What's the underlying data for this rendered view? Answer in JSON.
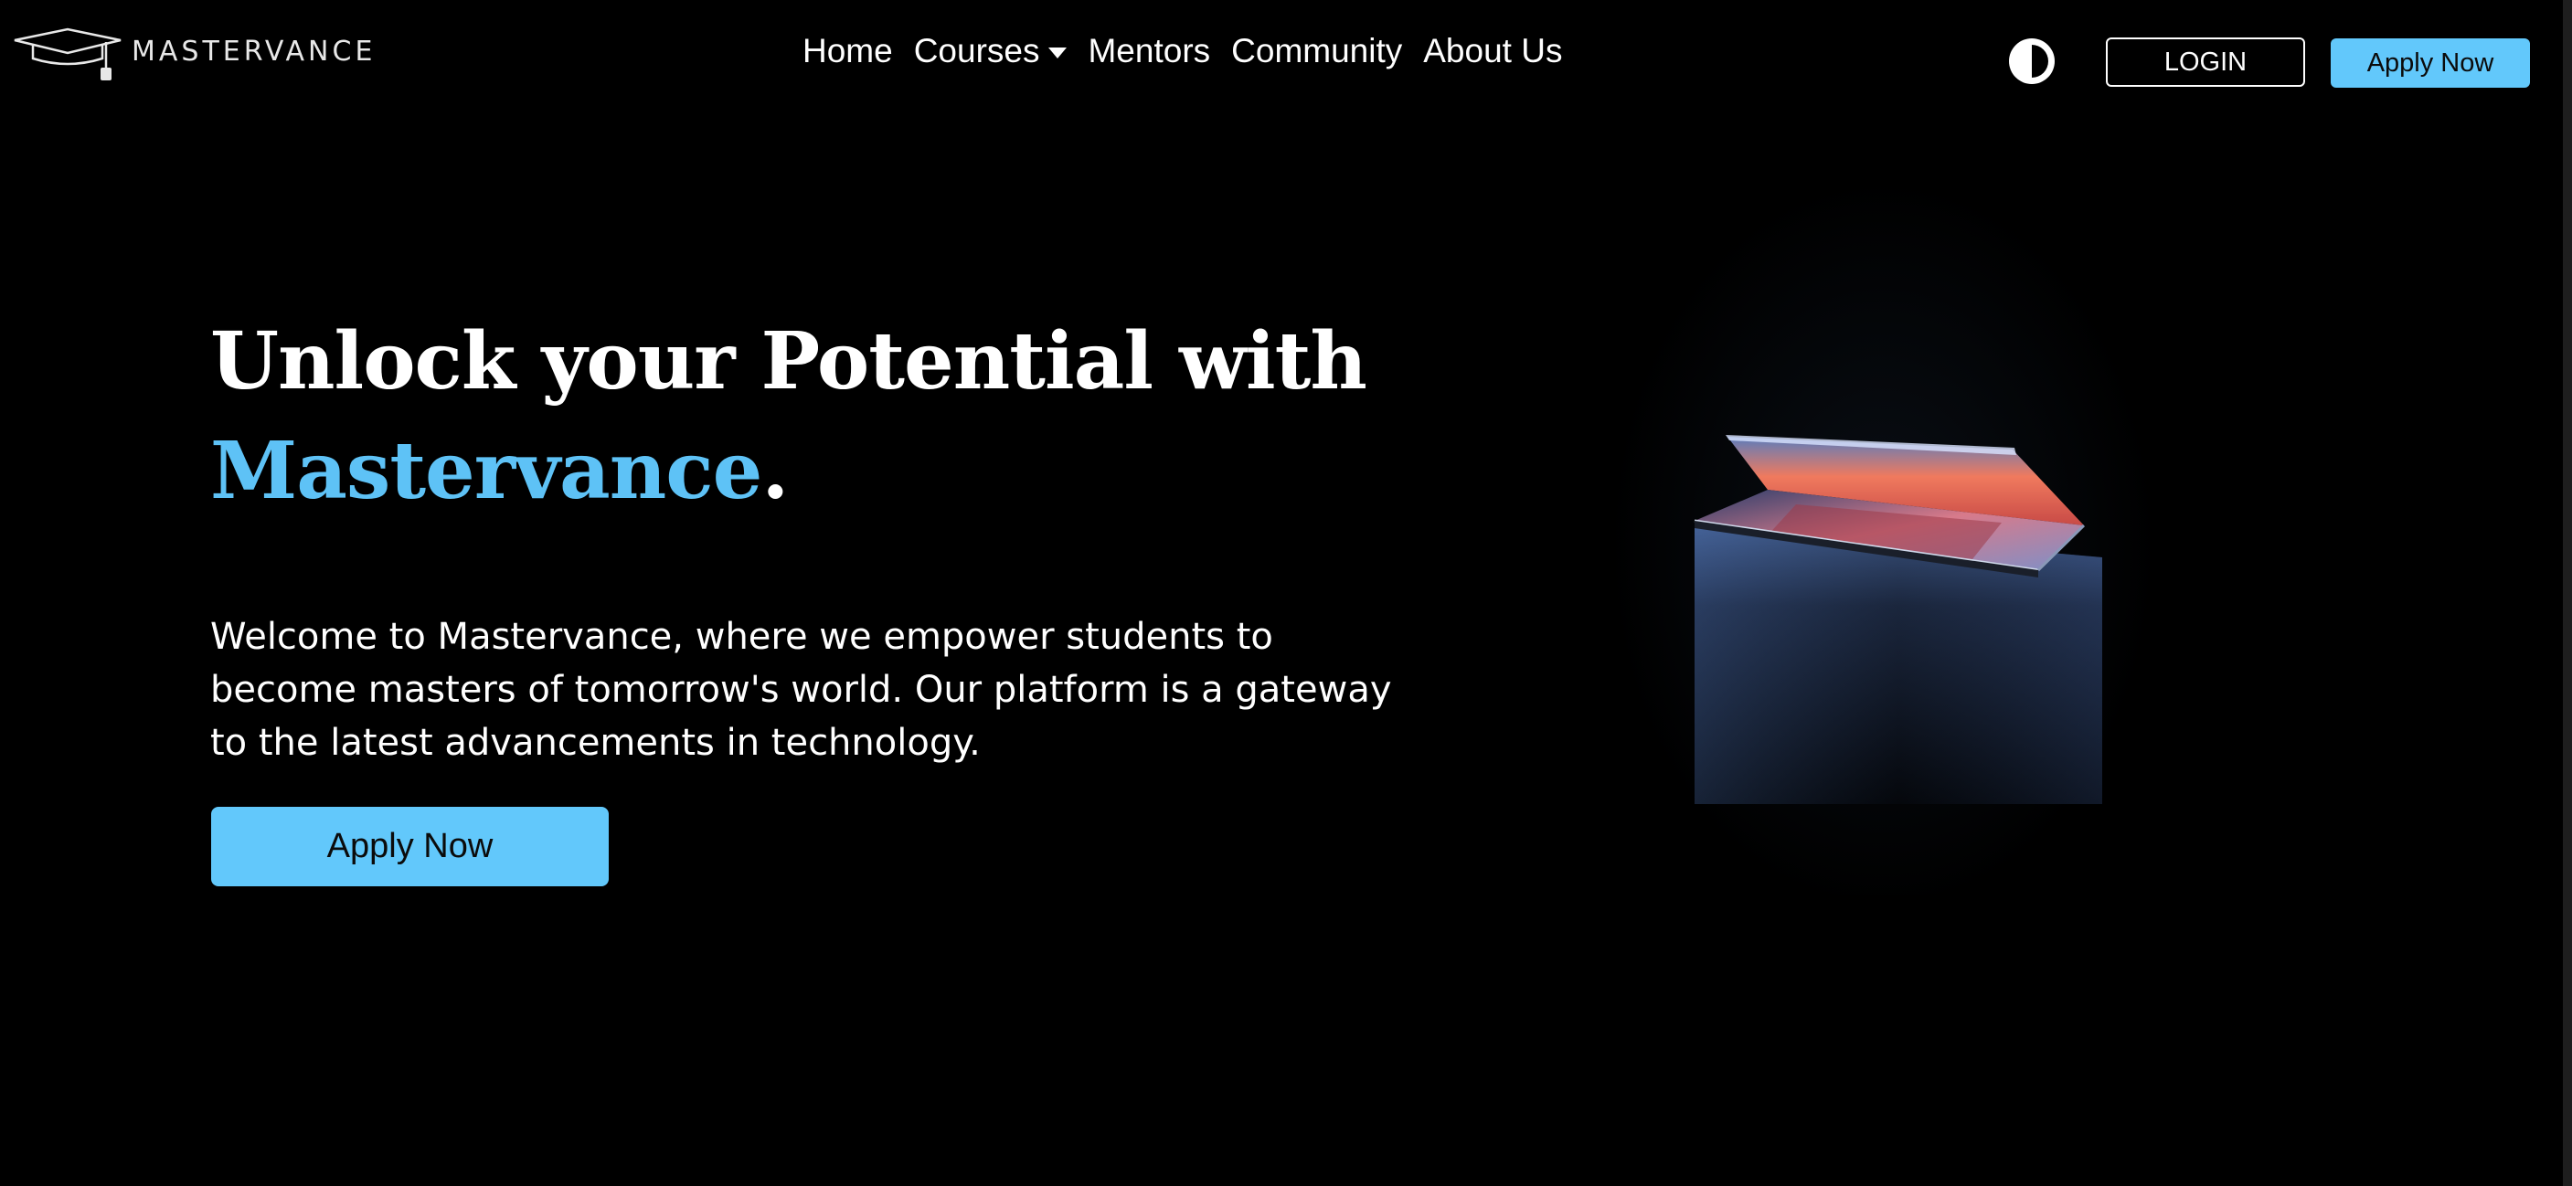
{
  "header": {
    "logo_text": "MASTERVANCE",
    "nav": [
      {
        "label": "Home"
      },
      {
        "label": "Courses",
        "has_dropdown": true
      },
      {
        "label": "Mentors"
      },
      {
        "label": "Community"
      },
      {
        "label": "About Us"
      }
    ],
    "theme_toggle_icon": "contrast-icon",
    "login_label": "LOGIN",
    "apply_label": "Apply Now"
  },
  "hero": {
    "title_line1": "Unlock your Potential with",
    "title_brand": "Mastervance",
    "title_period": ".",
    "description": "Welcome to Mastervance, where we empower students to become masters of tomorrow's world. Our platform is a gateway to the latest advancements in technology.",
    "cta_label": "Apply Now",
    "image_icon": "laptop-image"
  },
  "colors": {
    "background": "#000000",
    "accent": "#62c8fb",
    "text": "#ffffff"
  }
}
